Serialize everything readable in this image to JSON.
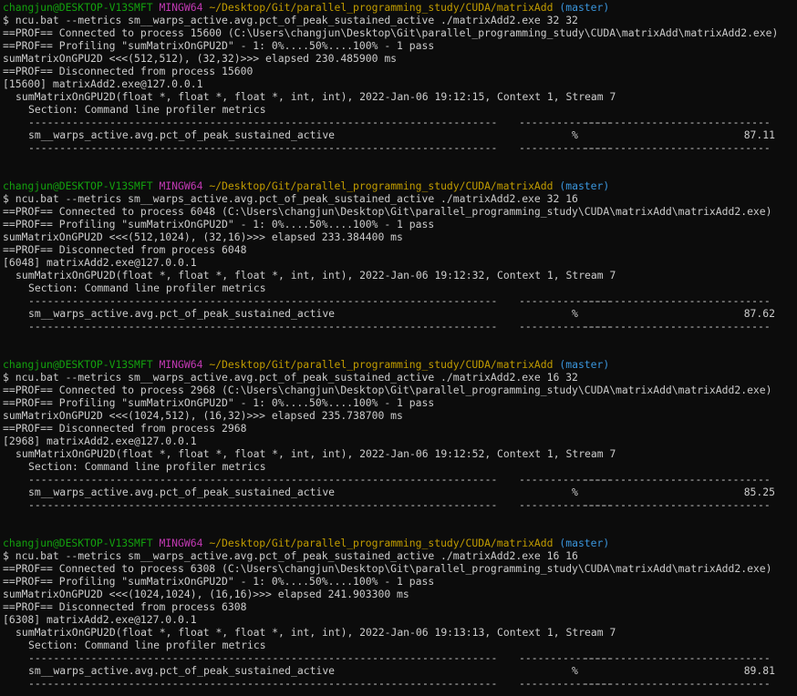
{
  "prompt": {
    "user_host": "changjun@DESKTOP-V13SMFT",
    "system": "MINGW64",
    "path": "~/Desktop/Git/parallel_programming_study/CUDA/matrixAdd",
    "branch": "(master)"
  },
  "profile_common": {
    "profiling_line": "==PROF== Profiling \"sumMatrixOnGPU2D\" - 1: 0%....50%....100% - 1 pass",
    "disconnected_prefix": "==PROF== Disconnected from process",
    "section_line": "Section: Command line profiler metrics",
    "dash_col1": "---------------------------------------------------------------------------",
    "dash_col2": "---------------",
    "dash_col3": "------------------------------",
    "metric_name": "sm__warps_active.avg.pct_of_peak_sustained_active",
    "metric_unit": "%"
  },
  "runs": [
    {
      "command": "$ ncu.bat --metrics sm__warps_active.avg.pct_of_peak_sustained_active ./matrixAdd2.exe 32 32",
      "connected": "==PROF== Connected to process 15600 (C:\\Users\\changjun\\Desktop\\Git\\parallel_programming_study\\CUDA\\matrixAdd\\matrixAdd2.exe)",
      "profiling": "==PROF== Profiling \"sumMatrixOnGPU2D\" - 1: 0%....50%....100% - 1 pass",
      "elapsed": "sumMatrixOnGPU2D <<<(512,512), (32,32)>>> elapsed 230.485900 ms",
      "disconnected": "==PROF== Disconnected from process 15600",
      "host": "[15600] matrixAdd2.exe@127.0.0.1",
      "kernel": "sumMatrixOnGPU2D(float *, float *, float *, int, int), 2022-Jan-06 19:12:15, Context 1, Stream 7",
      "value": "87.11"
    },
    {
      "command": "$ ncu.bat --metrics sm__warps_active.avg.pct_of_peak_sustained_active ./matrixAdd2.exe 32 16",
      "connected": "==PROF== Connected to process 6048 (C:\\Users\\changjun\\Desktop\\Git\\parallel_programming_study\\CUDA\\matrixAdd\\matrixAdd2.exe)",
      "profiling": "==PROF== Profiling \"sumMatrixOnGPU2D\" - 1: 0%....50%....100% - 1 pass",
      "elapsed": "sumMatrixOnGPU2D <<<(512,1024), (32,16)>>> elapsed 233.384400 ms",
      "disconnected": "==PROF== Disconnected from process 6048",
      "host": "[6048] matrixAdd2.exe@127.0.0.1",
      "kernel": "sumMatrixOnGPU2D(float *, float *, float *, int, int), 2022-Jan-06 19:12:32, Context 1, Stream 7",
      "value": "87.62"
    },
    {
      "command": "$ ncu.bat --metrics sm__warps_active.avg.pct_of_peak_sustained_active ./matrixAdd2.exe 16 32",
      "connected": "==PROF== Connected to process 2968 (C:\\Users\\changjun\\Desktop\\Git\\parallel_programming_study\\CUDA\\matrixAdd\\matrixAdd2.exe)",
      "profiling": "==PROF== Profiling \"sumMatrixOnGPU2D\" - 1: 0%....50%....100% - 1 pass",
      "elapsed": "sumMatrixOnGPU2D <<<(1024,512), (16,32)>>> elapsed 235.738700 ms",
      "disconnected": "==PROF== Disconnected from process 2968",
      "host": "[2968] matrixAdd2.exe@127.0.0.1",
      "kernel": "sumMatrixOnGPU2D(float *, float *, float *, int, int), 2022-Jan-06 19:12:52, Context 1, Stream 7",
      "value": "85.25"
    },
    {
      "command": "$ ncu.bat --metrics sm__warps_active.avg.pct_of_peak_sustained_active ./matrixAdd2.exe 16 16",
      "connected": "==PROF== Connected to process 6308 (C:\\Users\\changjun\\Desktop\\Git\\parallel_programming_study\\CUDA\\matrixAdd\\matrixAdd2.exe)",
      "profiling": "==PROF== Profiling \"sumMatrixOnGPU2D\" - 1: 0%....50%....100% - 1 pass",
      "elapsed": "sumMatrixOnGPU2D <<<(1024,1024), (16,16)>>> elapsed 241.903300 ms",
      "disconnected": "==PROF== Disconnected from process 6308",
      "host": "[6308] matrixAdd2.exe@127.0.0.1",
      "kernel": "sumMatrixOnGPU2D(float *, float *, float *, int, int), 2022-Jan-06 19:13:13, Context 1, Stream 7",
      "value": "89.81"
    }
  ],
  "colors": {
    "background": "#0c0c0c",
    "text": "#cccccc",
    "user_host": "#13a10e",
    "system": "#c239b3",
    "path": "#c19c00",
    "branch": "#3a96dd"
  }
}
